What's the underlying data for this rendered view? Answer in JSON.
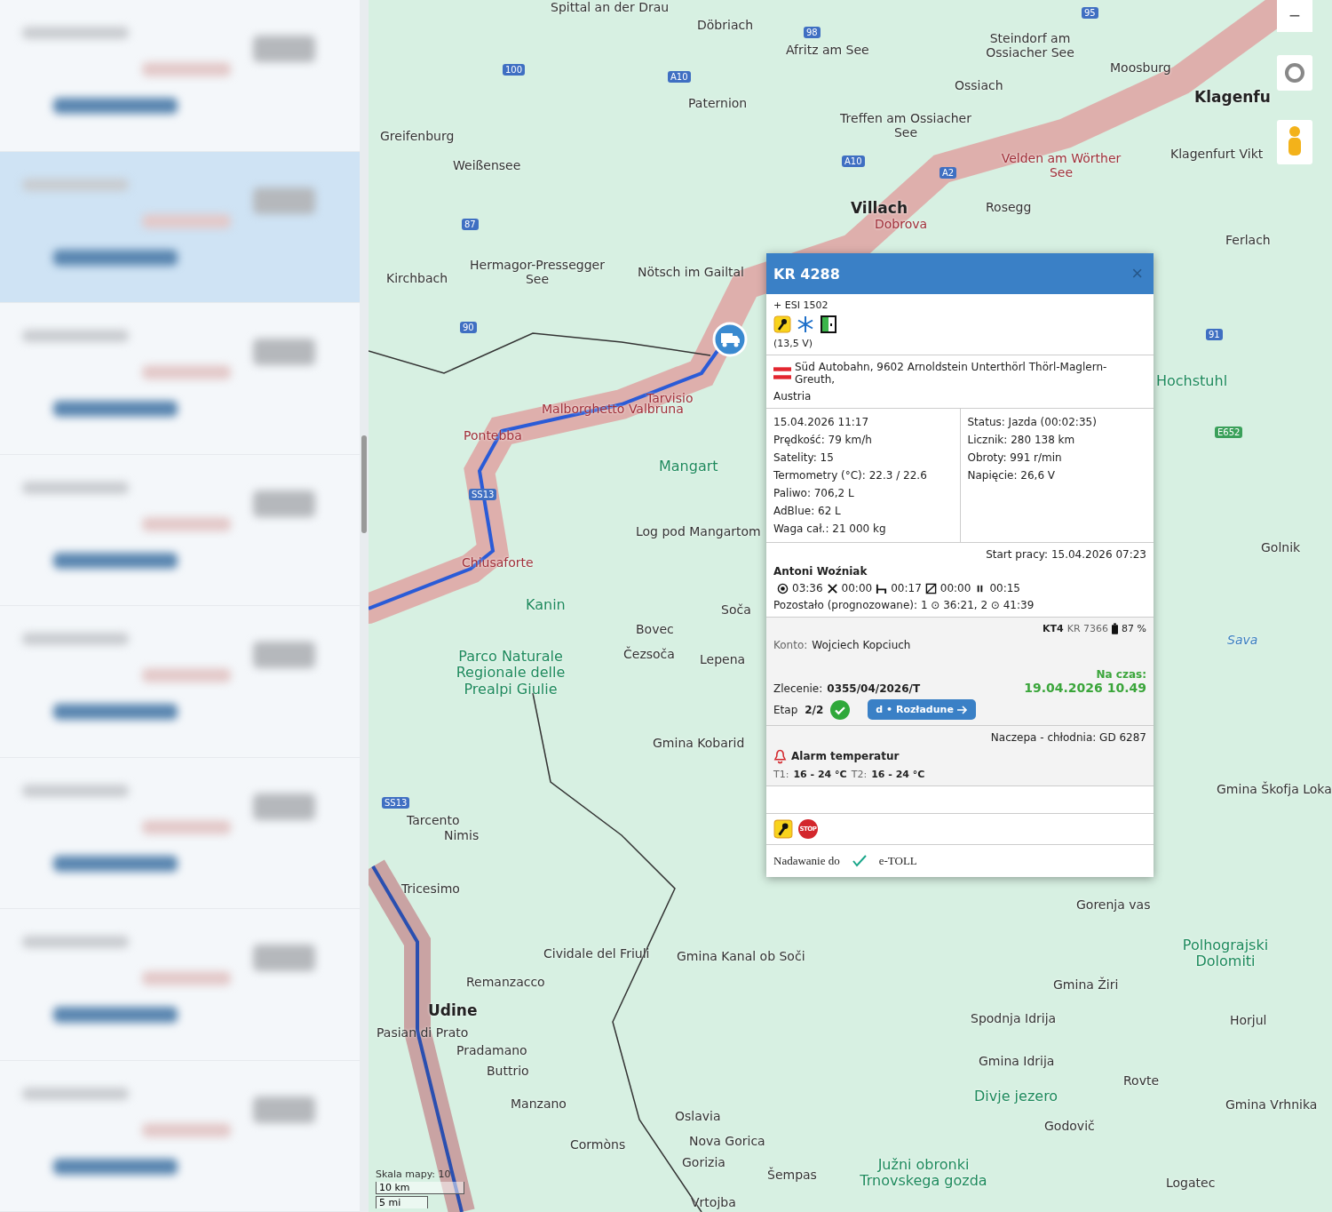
{
  "sidebar": {
    "row_count_selected": [
      false,
      true,
      false,
      false,
      false,
      false,
      false,
      false
    ]
  },
  "map": {
    "labels": [
      {
        "text": "Spittal an der Drau",
        "kind": "town"
      },
      {
        "text": "Döbriach",
        "kind": "town"
      },
      {
        "text": "Afritz am See",
        "kind": "town"
      },
      {
        "text": "Steindorf am Ossiacher See",
        "kind": "town"
      },
      {
        "text": "Moosburg",
        "kind": "town"
      },
      {
        "text": "Klagenfu",
        "kind": "city"
      },
      {
        "text": "Greifenburg",
        "kind": "town"
      },
      {
        "text": "Paternion",
        "kind": "town"
      },
      {
        "text": "Ossiach",
        "kind": "town"
      },
      {
        "text": "Treffen am Ossiacher See",
        "kind": "town"
      },
      {
        "text": "Weißensee",
        "kind": "town"
      },
      {
        "text": "Velden am Wörther See",
        "kind": "route"
      },
      {
        "text": "Klagenfurt Vikt",
        "kind": "town"
      },
      {
        "text": "Villach",
        "kind": "city"
      },
      {
        "text": "Dobrova",
        "kind": "route"
      },
      {
        "text": "Rosegg",
        "kind": "town"
      },
      {
        "text": "Ferlach",
        "kind": "town"
      },
      {
        "text": "Kirchbach",
        "kind": "town"
      },
      {
        "text": "Hermagor-Pressegger See",
        "kind": "town"
      },
      {
        "text": "Nötsch im Gailtal",
        "kind": "town"
      },
      {
        "text": "Hochstuhl",
        "kind": "park"
      },
      {
        "text": "Tarvisio",
        "kind": "route"
      },
      {
        "text": "Malborghetto Valbruna",
        "kind": "route"
      },
      {
        "text": "Pontebba",
        "kind": "route"
      },
      {
        "text": "Mangart",
        "kind": "park"
      },
      {
        "text": "Log pod Mangartom",
        "kind": "town"
      },
      {
        "text": "Chiusaforte",
        "kind": "route"
      },
      {
        "text": "Kanin",
        "kind": "park"
      },
      {
        "text": "Soča",
        "kind": "town"
      },
      {
        "text": "Bovec",
        "kind": "town"
      },
      {
        "text": "Čezsoča",
        "kind": "town"
      },
      {
        "text": "Lepena",
        "kind": "town"
      },
      {
        "text": "Parco Naturale Regionale delle Prealpi Giulie",
        "kind": "park"
      },
      {
        "text": "Gmina Kobarid",
        "kind": "town"
      },
      {
        "text": "Tarcento",
        "kind": "town"
      },
      {
        "text": "Nimis",
        "kind": "town"
      },
      {
        "text": "Tricesimo",
        "kind": "town"
      },
      {
        "text": "Cividale del Friuli",
        "kind": "town"
      },
      {
        "text": "Gmina Kanal ob Soči",
        "kind": "town"
      },
      {
        "text": "Remanzacco",
        "kind": "town"
      },
      {
        "text": "Udine",
        "kind": "city"
      },
      {
        "text": "Pasian di Prato",
        "kind": "town"
      },
      {
        "text": "Pradamano",
        "kind": "town"
      },
      {
        "text": "Buttrio",
        "kind": "town"
      },
      {
        "text": "Manzano",
        "kind": "town"
      },
      {
        "text": "Oslavia",
        "kind": "town"
      },
      {
        "text": "Cormòns",
        "kind": "town"
      },
      {
        "text": "Nova Gorica",
        "kind": "town"
      },
      {
        "text": "Gorizia",
        "kind": "town"
      },
      {
        "text": "Šempas",
        "kind": "town"
      },
      {
        "text": "Južni obronki Trnovskega gozda",
        "kind": "park"
      },
      {
        "text": "Vrtojba",
        "kind": "town"
      },
      {
        "text": "Gorenja vas",
        "kind": "town"
      },
      {
        "text": "Polhograjski Dolomiti",
        "kind": "park"
      },
      {
        "text": "Gmina Žiri",
        "kind": "town"
      },
      {
        "text": "Spodnja Idrija",
        "kind": "town"
      },
      {
        "text": "Horjul",
        "kind": "town"
      },
      {
        "text": "Gmina Idrija",
        "kind": "town"
      },
      {
        "text": "Rovte",
        "kind": "town"
      },
      {
        "text": "Divje jezero",
        "kind": "park"
      },
      {
        "text": "Godovič",
        "kind": "town"
      },
      {
        "text": "Gmina Vrhnika",
        "kind": "town"
      },
      {
        "text": "Logatec",
        "kind": "town"
      },
      {
        "text": "Gmina Škofja Loka",
        "kind": "town"
      },
      {
        "text": "Sava",
        "kind": "water"
      },
      {
        "text": "Golnik",
        "kind": "town"
      }
    ],
    "shields": [
      {
        "text": "98",
        "kind": "blue"
      },
      {
        "text": "95",
        "kind": "blue"
      },
      {
        "text": "100",
        "kind": "blue"
      },
      {
        "text": "A10",
        "kind": "blue"
      },
      {
        "text": "A10",
        "kind": "blue"
      },
      {
        "text": "A2",
        "kind": "blue"
      },
      {
        "text": "87",
        "kind": "blue"
      },
      {
        "text": "90",
        "kind": "blue"
      },
      {
        "text": "91",
        "kind": "blue"
      },
      {
        "text": "E652",
        "kind": "green"
      },
      {
        "text": "SS13",
        "kind": "blue"
      },
      {
        "text": "SS13",
        "kind": "blue"
      }
    ],
    "zoom_out": "−",
    "scale": {
      "caption": "Skala mapy: 10",
      "metric": "10 km",
      "imperial": "5 mi"
    }
  },
  "popup": {
    "title": "KR 4288",
    "close": "×",
    "trailer": "+ ESI 1502",
    "voltage": "(13,5 V)",
    "address": "Süd Autobahn, 9602 Arnoldstein Unterthörl Thörl-Maglern-Greuth,",
    "country": "Austria",
    "left_stats": [
      "15.04.2026 11:17",
      "Prędkość: 79 km/h",
      "Satelity: 15",
      "Termometry (°C): 22.3 / 22.6",
      "Paliwo: 706,2 L",
      "AdBlue: 62 L",
      "Waga cał.: 21 000 kg"
    ],
    "right_stats": [
      "Status: Jazda (00:02:35)",
      "Licznik: 280 138 km",
      "Obroty: 991 r/min",
      "Napięcie: 26,6 V"
    ],
    "work_start": "Start pracy: 15.04.2026 07:23",
    "driver": "Antoni Woźniak",
    "times": [
      {
        "kind": "driving",
        "value": "03:36"
      },
      {
        "kind": "work",
        "value": "00:00"
      },
      {
        "kind": "rest",
        "value": "00:17"
      },
      {
        "kind": "available",
        "value": "00:00"
      },
      {
        "kind": "break",
        "value": "00:15"
      }
    ],
    "remaining": "Pozostało (prognozowane): 1 ⊙ 36:21, 2 ⊙ 41:39",
    "device": {
      "model": "KT4",
      "plate": "KR 7366",
      "battery": "87 %"
    },
    "account": {
      "label": "Konto:",
      "value": "Wojciech Kopciuch"
    },
    "order": {
      "label": "Zlecenie:",
      "value": "0355/04/2026/T"
    },
    "on_time": {
      "label": "Na czas:",
      "value": "19.04.2026 10.49"
    },
    "stage": {
      "label": "Etap",
      "value": "2/2",
      "done": true,
      "button": "d • Rozładune"
    },
    "trailer_type": "Naczepa - chłodnia: GD 6287",
    "alarm": "Alarm temperatur",
    "ranges": [
      {
        "label": "T1:",
        "value": "16 - 24 °C"
      },
      {
        "label": "T2:",
        "value": "16 - 24 °C"
      }
    ],
    "stop_sign": "STOP",
    "broadcast": {
      "label": "Nadawanie do",
      "enabled": true,
      "target": "e-TOLL"
    }
  }
}
